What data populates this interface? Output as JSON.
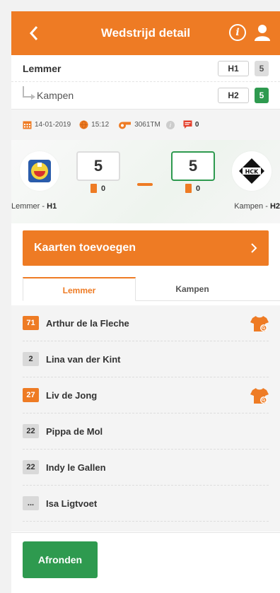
{
  "header": {
    "title": "Wedstrijd detail"
  },
  "teams": {
    "home": {
      "name": "Lemmer",
      "tag": "H1",
      "score": "5"
    },
    "away": {
      "name": "Kampen",
      "tag": "H2",
      "score": "5"
    }
  },
  "meta": {
    "date": "14-01-2019",
    "time": "15:12",
    "referee": "3061TM",
    "comments": "0"
  },
  "board": {
    "home": {
      "score": "5",
      "cards": "0",
      "name": "Lemmer - ",
      "team": "H1"
    },
    "away": {
      "score": "5",
      "cards": "0",
      "name": "Kampen - ",
      "team": "H2"
    }
  },
  "cta": {
    "label": "Kaarten toevoegen"
  },
  "tabs": [
    "Lemmer",
    "Kampen"
  ],
  "players": [
    {
      "number": "71",
      "name": "Arthur de la Fleche",
      "highlight": true,
      "shirt": true
    },
    {
      "number": "2",
      "name": "Lina van der Kint",
      "highlight": false,
      "shirt": false
    },
    {
      "number": "27",
      "name": "Liv de Jong",
      "highlight": true,
      "shirt": true
    },
    {
      "number": "22",
      "name": "Pippa de Mol",
      "highlight": false,
      "shirt": false
    },
    {
      "number": "22",
      "name": "Indy le Gallen",
      "highlight": false,
      "shirt": false
    },
    {
      "number": "...",
      "name": "Isa Ligtvoet",
      "highlight": false,
      "shirt": false
    }
  ],
  "footer": {
    "button": "Afronden"
  },
  "colors": {
    "accent": "#ee7b24",
    "success": "#2e9a4f"
  }
}
